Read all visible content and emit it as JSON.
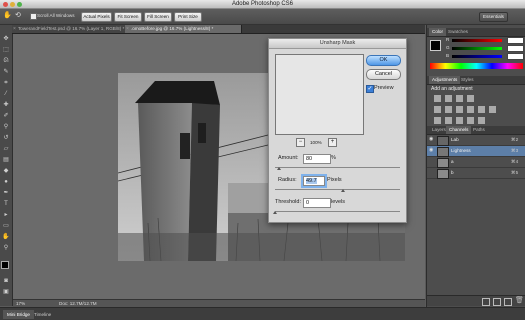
{
  "window": {
    "title": "Adobe Photoshop CS6"
  },
  "options_bar": {
    "scroll_all_windows": "Scroll All Windows",
    "buttons": [
      "Actual Pixels",
      "Fit Screen",
      "Fill Screen",
      "Print Size"
    ],
    "workspace": "Essentials"
  },
  "doc_tabs": [
    {
      "label": "TowerandFieldTest.psd @ 16.7% (Layer 1, RGB/8) *",
      "active": false
    },
    {
      "label": ".omoBefore.jpg @ 16.7% (Lightness/8) *",
      "active": true
    }
  ],
  "status": {
    "zoom": "17%",
    "doc": "Doc: 12.7M/12.7M"
  },
  "bottom_tabs": [
    "Mini Bridge",
    "Timeline"
  ],
  "dialog": {
    "title": "Unsharp Mask",
    "ok": "OK",
    "cancel": "Cancel",
    "preview_label": "Preview",
    "preview_checked": true,
    "zoom_label": "100%",
    "amount_label": "Amount:",
    "amount_value": "80",
    "amount_unit": "%",
    "radius_label": "Radius:",
    "radius_value": "49.7",
    "radius_unit": "Pixels",
    "threshold_label": "Threshold:",
    "threshold_value": "0",
    "threshold_unit": "levels"
  },
  "color_panel": {
    "tabs": [
      "Color",
      "Swatches"
    ],
    "channels": [
      "R",
      "G",
      "B"
    ]
  },
  "adjustments_panel": {
    "tabs": [
      "Adjustments",
      "Styles"
    ],
    "heading": "Add an adjustment"
  },
  "layers_panel": {
    "tabs": [
      "Layers",
      "Channels",
      "Paths"
    ],
    "active_tab": "Channels",
    "channels": [
      {
        "name": "Lab",
        "key": "⌘2",
        "selected": false
      },
      {
        "name": "Lightness",
        "key": "⌘3",
        "selected": true
      },
      {
        "name": "a",
        "key": "⌘4",
        "selected": false
      },
      {
        "name": "b",
        "key": "⌘5",
        "selected": false
      }
    ]
  },
  "colors": {
    "accent": "#4f97e6",
    "selection": "#5d7fa8"
  }
}
